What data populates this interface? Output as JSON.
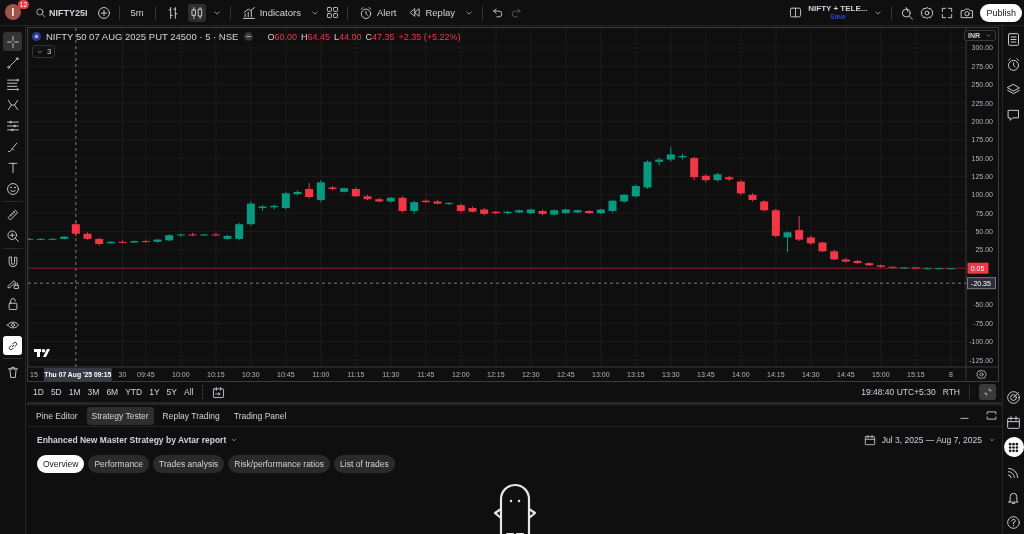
{
  "top_bar": {
    "avatar": "I",
    "notifications": "12",
    "symbol": "NIFTY25I",
    "interval": "5m",
    "chart_types": [
      {
        "kind": "bars",
        "selected": false
      },
      {
        "kind": "candles",
        "selected": true
      }
    ],
    "indicators": "Indicators",
    "alert": "Alert",
    "replay": "Replay",
    "layout": {
      "name": "NIFTY + TELE...",
      "status": "Save"
    },
    "publish": "Publish"
  },
  "left_toolbar": [
    [
      {
        "kind": "crosshair",
        "selected": true,
        "on": false
      },
      {
        "kind": "trendline",
        "selected": false,
        "on": false
      },
      {
        "kind": "fib",
        "selected": false,
        "on": false
      },
      {
        "kind": "pattern",
        "selected": false,
        "on": false
      },
      {
        "kind": "forecast",
        "selected": false,
        "on": false
      },
      {
        "kind": "brush",
        "selected": false,
        "on": false
      },
      {
        "kind": "text",
        "selected": false,
        "on": false
      },
      {
        "kind": "emoji",
        "selected": false,
        "on": false
      }
    ],
    [
      {
        "kind": "ruler",
        "selected": false,
        "on": false
      },
      {
        "kind": "zoom",
        "selected": false,
        "on": false
      }
    ],
    [
      {
        "kind": "magnet",
        "selected": false,
        "on": false
      },
      {
        "kind": "lockdraw",
        "selected": false,
        "on": false
      },
      {
        "kind": "lock",
        "selected": false,
        "on": false
      },
      {
        "kind": "eye",
        "selected": false,
        "on": false
      },
      {
        "kind": "link",
        "selected": false,
        "on": true
      }
    ],
    [
      {
        "kind": "trash",
        "selected": false,
        "on": false
      }
    ]
  ],
  "chart": {
    "legend": {
      "symbol": "NIFTY 50 07 AUG 2025 PUT 24500 · 5 · NSE",
      "ohlc": [
        {
          "label": "O",
          "value": "60.00"
        },
        {
          "label": "H",
          "value": "64.45"
        },
        {
          "label": "L",
          "value": "44.00"
        },
        {
          "label": "C",
          "value": "47.35"
        }
      ],
      "change": "+2.35 (+5.22%)",
      "indicator_count": "3"
    },
    "currency": "INR",
    "chart_data": {
      "type": "candlestick",
      "ylim": [
        -134.5,
        327.2
      ],
      "categories": [
        "15",
        null,
        null,
        null,
        null,
        null,
        null,
        null,
        "30",
        null,
        "09:45",
        null,
        null,
        "10:00",
        null,
        null,
        "10:15",
        null,
        null,
        "10:30",
        null,
        null,
        "10:45",
        null,
        null,
        "11:00",
        null,
        null,
        "11:15",
        null,
        null,
        "11:30",
        null,
        null,
        "11:45",
        null,
        null,
        "12:00",
        null,
        null,
        "12:15",
        null,
        null,
        "12:30",
        null,
        null,
        "12:45",
        null,
        null,
        "13:00",
        null,
        null,
        "13:15",
        null,
        null,
        "13:30",
        null,
        null,
        "13:45",
        null,
        null,
        "14:00",
        null,
        null,
        "14:15",
        null,
        null,
        "14:30",
        null,
        null,
        "14:45",
        null,
        null,
        "15:00",
        null,
        null,
        "15:15",
        null,
        null,
        "8"
      ],
      "ohlc": [
        [
          39,
          41,
          38,
          40
        ],
        [
          40,
          41,
          39,
          40
        ],
        [
          40,
          41,
          39,
          40
        ],
        [
          40,
          44,
          39,
          43
        ],
        [
          60,
          64,
          44,
          47
        ],
        [
          47,
          49,
          39,
          40
        ],
        [
          40,
          41,
          31,
          33
        ],
        [
          34,
          37,
          33,
          36
        ],
        [
          36,
          38,
          34,
          35
        ],
        [
          35,
          38,
          34,
          37
        ],
        [
          37,
          39,
          35,
          36
        ],
        [
          36,
          40,
          35,
          39
        ],
        [
          38,
          46,
          37,
          45
        ],
        [
          45,
          47,
          43,
          46
        ],
        [
          46,
          48,
          44,
          45
        ],
        [
          45,
          47,
          44,
          46
        ],
        [
          46,
          48,
          44,
          45
        ],
        [
          40,
          45,
          39,
          44
        ],
        [
          40,
          62,
          38,
          60
        ],
        [
          60,
          91,
          58,
          88
        ],
        [
          82,
          86,
          78,
          84
        ],
        [
          83,
          87,
          80,
          85
        ],
        [
          82,
          104,
          80,
          102
        ],
        [
          101,
          106,
          99,
          104
        ],
        [
          108,
          116,
          95,
          97
        ],
        [
          93,
          120,
          90,
          117
        ],
        [
          110,
          112,
          106,
          108
        ],
        [
          104,
          110,
          103,
          109
        ],
        [
          108,
          110,
          97,
          98
        ],
        [
          98,
          100,
          93,
          94
        ],
        [
          94,
          96,
          90,
          91
        ],
        [
          91,
          97,
          89,
          96
        ],
        [
          96,
          98,
          76,
          78
        ],
        [
          78,
          92,
          74,
          90
        ],
        [
          92,
          94,
          89,
          90
        ],
        [
          91,
          93,
          87,
          88
        ],
        [
          88,
          90,
          86,
          89
        ],
        [
          86,
          88,
          76,
          78
        ],
        [
          82,
          84,
          76,
          77
        ],
        [
          80,
          82,
          72,
          74
        ],
        [
          77,
          78,
          73,
          75
        ],
        [
          75,
          78,
          73,
          77
        ],
        [
          76,
          80,
          75,
          79
        ],
        [
          75,
          81,
          74,
          80
        ],
        [
          78,
          80,
          72,
          74
        ],
        [
          73,
          80,
          72,
          79
        ],
        [
          75,
          81,
          74,
          80
        ],
        [
          76,
          80,
          75,
          79
        ],
        [
          78,
          79,
          74,
          75
        ],
        [
          75,
          81,
          74,
          80
        ],
        [
          78,
          93,
          76,
          92
        ],
        [
          91,
          101,
          89,
          100
        ],
        [
          98,
          114,
          96,
          112
        ],
        [
          110,
          147,
          108,
          145
        ],
        [
          145,
          150,
          140,
          148
        ],
        [
          148,
          165,
          145,
          155
        ],
        [
          151,
          156,
          148,
          153
        ],
        [
          150,
          152,
          120,
          124
        ],
        [
          126,
          128,
          117,
          120
        ],
        [
          120,
          130,
          118,
          128
        ],
        [
          124,
          126,
          119,
          121
        ],
        [
          118,
          120,
          100,
          102
        ],
        [
          100,
          102,
          91,
          93
        ],
        [
          91,
          93,
          77,
          79
        ],
        [
          79,
          81,
          42,
          44
        ],
        [
          42,
          50,
          22,
          49
        ],
        [
          52,
          71,
          37,
          39
        ],
        [
          42,
          44,
          32,
          34
        ],
        [
          35,
          36,
          22,
          23
        ],
        [
          23,
          25,
          11,
          12
        ],
        [
          12,
          14,
          8,
          9
        ],
        [
          10,
          11,
          6,
          7
        ],
        [
          7,
          8,
          3,
          4
        ],
        [
          4,
          5,
          1,
          2
        ],
        [
          2,
          2,
          0,
          1
        ],
        [
          1,
          2,
          0,
          1
        ],
        [
          1,
          1,
          0,
          0
        ],
        [
          0,
          1,
          0,
          0
        ],
        [
          0,
          0,
          0,
          0
        ],
        [
          0,
          0,
          0,
          0
        ]
      ],
      "yticks": [
        {
          "value": 300,
          "label": "300.00"
        },
        {
          "value": 275,
          "label": "275.00"
        },
        {
          "value": 250,
          "label": "250.00"
        },
        {
          "value": 225,
          "label": "225.00"
        },
        {
          "value": 200,
          "label": "200.00"
        },
        {
          "value": 175,
          "label": "175.00"
        },
        {
          "value": 150,
          "label": "150.00"
        },
        {
          "value": 125,
          "label": "125.00"
        },
        {
          "value": 100,
          "label": "100.00"
        },
        {
          "value": 75,
          "label": "75.00"
        },
        {
          "value": 50,
          "label": "50.00"
        },
        {
          "value": 25,
          "label": "25.00"
        },
        {
          "value": -50,
          "label": "-50.00"
        },
        {
          "value": -75,
          "label": "-75.00"
        },
        {
          "value": -100,
          "label": "-100.00"
        },
        {
          "value": -125,
          "label": "-125.00"
        }
      ],
      "grid": true,
      "ref_lines": [
        {
          "axis": "y",
          "value": 0.05,
          "label": "0.05",
          "color": "#f23645"
        },
        {
          "axis": "y",
          "value": -20.35,
          "label": "-20.35",
          "color": "#787b86"
        }
      ]
    },
    "crosshair_time": "Thu 07 Aug '25 09:15"
  },
  "range_bar": {
    "ranges": [
      "1D",
      "5D",
      "1M",
      "3M",
      "6M",
      "YTD",
      "1Y",
      "5Y",
      "All"
    ],
    "clock": "19:48:40 UTC+5:30",
    "session": "RTH"
  },
  "bottom_panel": {
    "tabs": [
      {
        "label": "Pine Editor",
        "selected": false
      },
      {
        "label": "Strategy Tester",
        "selected": true
      },
      {
        "label": "Replay Trading",
        "selected": false
      },
      {
        "label": "Trading Panel",
        "selected": false
      }
    ],
    "report": "Enhanced New Master Strategy by Avtar report",
    "date_range": "Jul 3, 2025 — Aug 7, 2025",
    "sections": [
      {
        "label": "Overview",
        "selected": true
      },
      {
        "label": "Performance",
        "selected": false
      },
      {
        "label": "Trades analysis",
        "selected": false
      },
      {
        "label": "Risk/performance ratios",
        "selected": false
      },
      {
        "label": "List of trades",
        "selected": false
      }
    ]
  },
  "right_sidebar": {
    "top": [
      {
        "kind": "watchlist",
        "selected": false
      },
      {
        "kind": "alerts",
        "selected": false
      },
      {
        "kind": "layers",
        "selected": false
      },
      {
        "kind": "chat",
        "selected": false
      }
    ],
    "bottom": [
      {
        "kind": "target",
        "selected": false
      },
      {
        "kind": "calendar",
        "selected": false
      },
      {
        "kind": "apps",
        "selected": true
      },
      {
        "kind": "feed",
        "selected": false
      },
      {
        "kind": "bell",
        "selected": false
      },
      {
        "kind": "help",
        "selected": false
      }
    ]
  }
}
